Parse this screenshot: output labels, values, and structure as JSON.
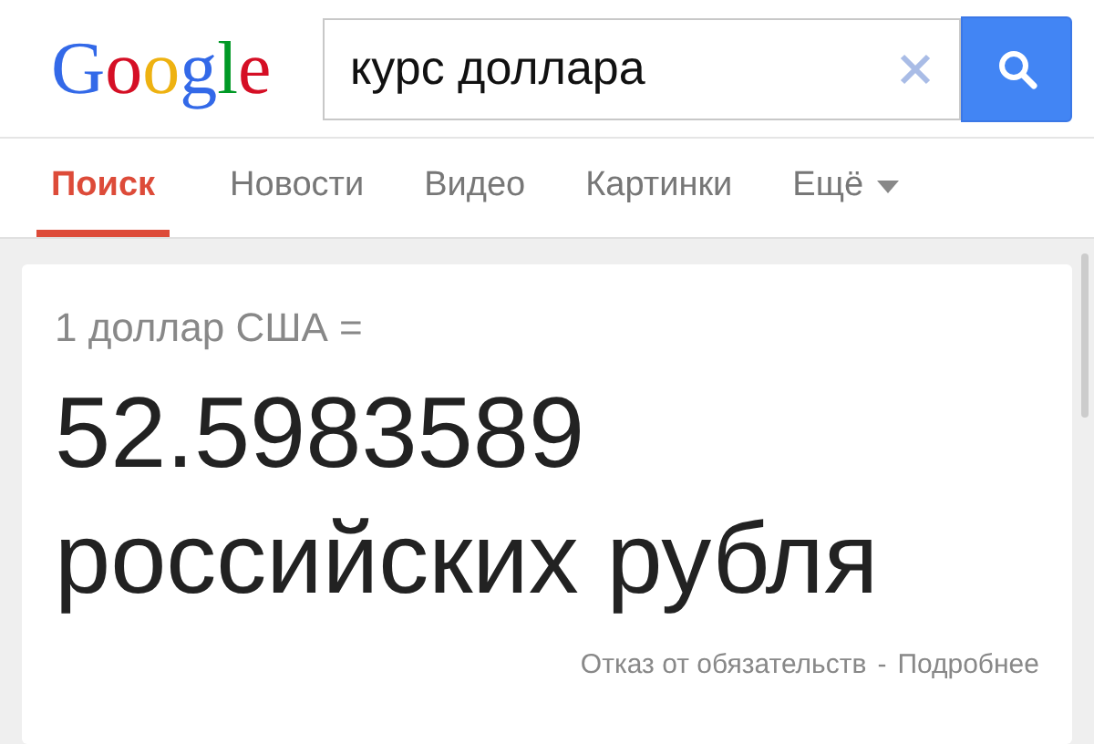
{
  "header": {
    "logo": "Google",
    "search": {
      "value": "курс доллара"
    }
  },
  "tabs": [
    {
      "label": "Поиск",
      "selected": true,
      "kind": "tab"
    },
    {
      "label": "Новости",
      "selected": false,
      "kind": "tab"
    },
    {
      "label": "Видео",
      "selected": false,
      "kind": "tab"
    },
    {
      "label": "Картинки",
      "selected": false,
      "kind": "tab"
    },
    {
      "label": "Ещё",
      "selected": false,
      "kind": "menu"
    }
  ],
  "result": {
    "from": "1 доллар США =",
    "amount": "52.5983589",
    "unit": "российских рубля",
    "footer": {
      "disclaimer": "Отказ от обязательств",
      "separator": "-",
      "more": "Подробнее"
    }
  }
}
